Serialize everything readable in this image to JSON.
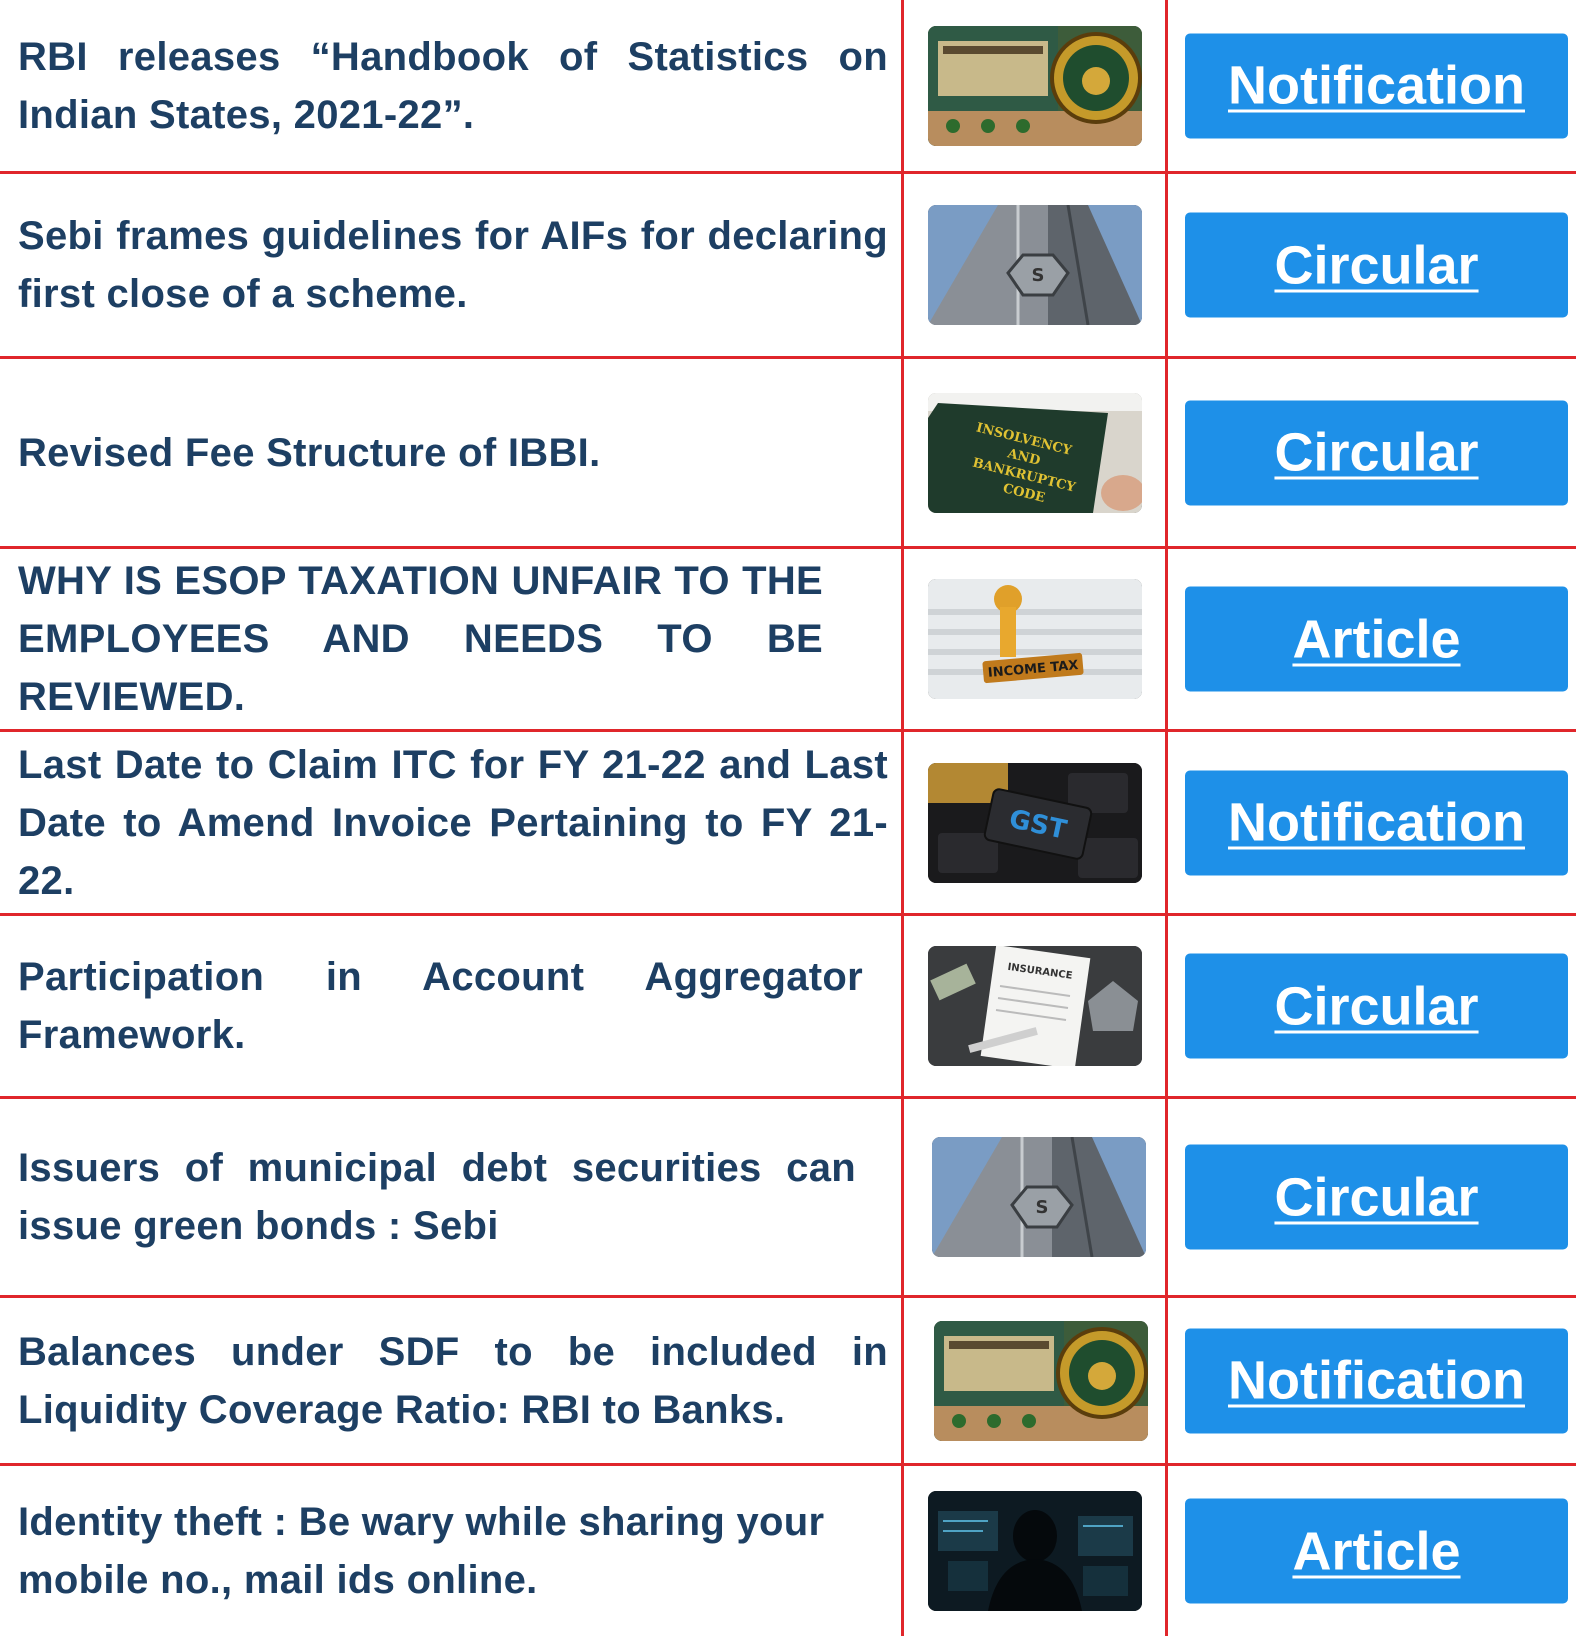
{
  "colors": {
    "divider": "#e0262b",
    "title_text": "#1d3f63",
    "button_bg": "#1e90e8",
    "button_text": "#ffffff"
  },
  "rows": [
    {
      "title": "RBI releases “Handbook of Statistics on Indian States, 2021-22”.",
      "image": "rbi-building-icon",
      "button": "Notification"
    },
    {
      "title": "Sebi frames guidelines for AIFs for declaring first close of a scheme.",
      "image": "sebi-building-icon",
      "button": "Circular"
    },
    {
      "title": "Revised Fee Structure of IBBI.",
      "image": "ibc-book-icon",
      "button": "Circular",
      "image_text": "INSOLVENCY AND BANKRUPTCY CODE"
    },
    {
      "title": "WHY IS ESOP TAXATION UNFAIR TO THE EMPLOYEES AND NEEDS TO BE REVIEWED.",
      "image": "income-tax-stamp-icon",
      "button": "Article",
      "image_text": "INCOME TAX"
    },
    {
      "title": "Last Date to Claim ITC for FY 21-22 and Last Date to Amend Invoice Pertaining to FY 21-22.",
      "image": "gst-key-icon",
      "button": "Notification",
      "image_text": "GST"
    },
    {
      "title": "Participation in Account Aggregator Framework.",
      "image": "insurance-document-icon",
      "button": "Circular",
      "image_text": "INSURANCE"
    },
    {
      "title": "Issuers of municipal debt securities can issue green bonds : Sebi",
      "image": "sebi-building-icon",
      "button": "Circular"
    },
    {
      "title": "Balances under SDF to be included in Liquidity Coverage Ratio: RBI to Banks.",
      "image": "rbi-building-icon",
      "button": "Notification"
    },
    {
      "title": "Identity theft : Be wary while sharing your mobile no., mail ids online.",
      "image": "hacker-icon",
      "button": "Article"
    }
  ]
}
